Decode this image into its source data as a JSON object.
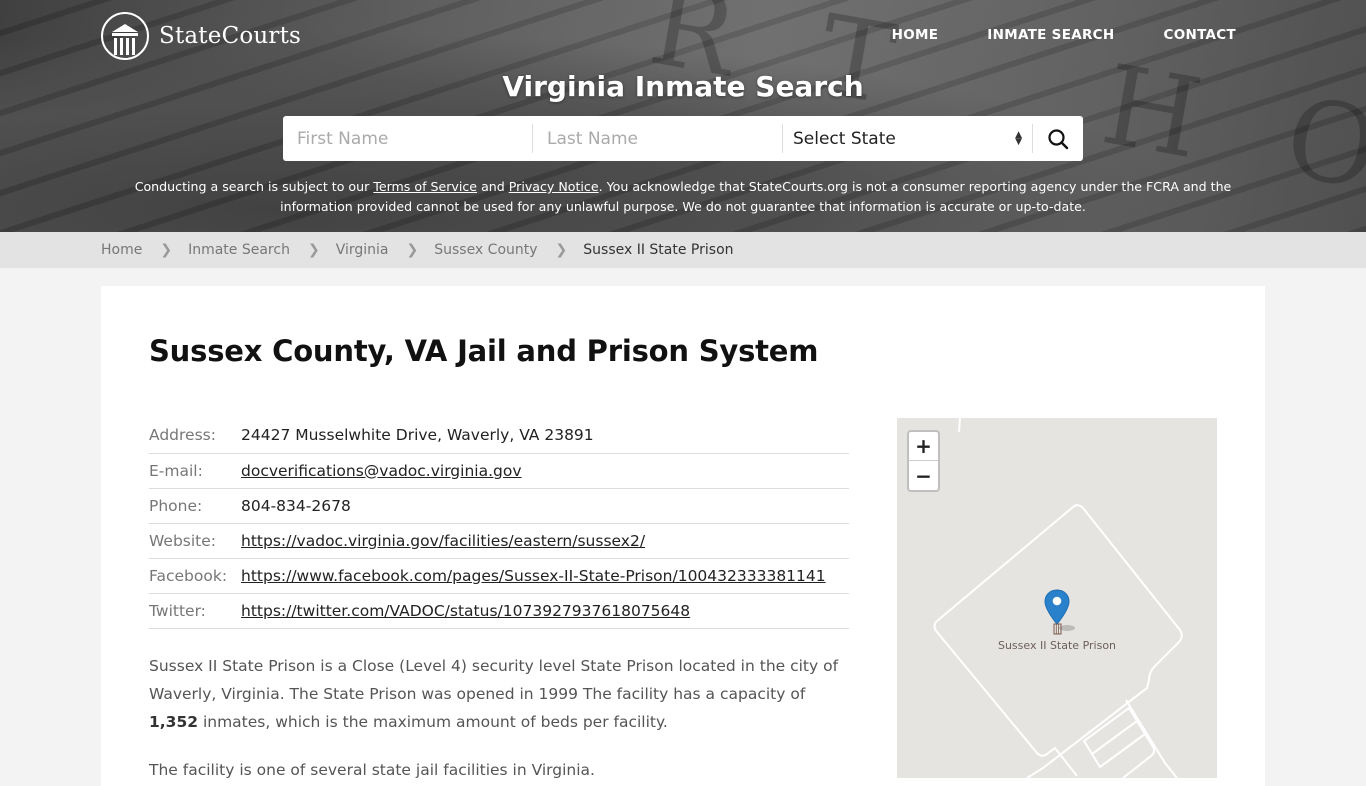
{
  "header": {
    "logo_text": "StateCourts",
    "nav": [
      "HOME",
      "INMATE SEARCH",
      "CONTACT"
    ],
    "title": "Virginia Inmate Search",
    "search": {
      "first_name_placeholder": "First Name",
      "last_name_placeholder": "Last Name",
      "state_select": "Select State"
    },
    "disclaimer": {
      "part1": "Conducting a search is subject to our ",
      "terms_link": "Terms of Service",
      "part2": " and ",
      "privacy_link": "Privacy Notice",
      "part3": ". You acknowledge that StateCourts.org is not a consumer reporting agency under the FCRA and the information provided cannot be used for any unlawful purpose. We do not guarantee that information is accurate or up-to-date."
    }
  },
  "breadcrumb": [
    "Home",
    "Inmate Search",
    "Virginia",
    "Sussex County",
    "Sussex II State Prison"
  ],
  "main": {
    "heading": "Sussex County, VA Jail and Prison System",
    "info": [
      {
        "label": "Address:",
        "value": "24427 Musselwhite Drive, Waverly, VA 23891",
        "link": false
      },
      {
        "label": "E-mail:",
        "value": "docverifications@vadoc.virginia.gov",
        "link": true
      },
      {
        "label": "Phone:",
        "value": "804-834-2678",
        "link": false
      },
      {
        "label": "Website:",
        "value": "https://vadoc.virginia.gov/facilities/eastern/sussex2/",
        "link": true
      },
      {
        "label": "Facebook:",
        "value": "https://www.facebook.com/pages/Sussex-II-State-Prison/100432333381141",
        "link": true
      },
      {
        "label": "Twitter:",
        "value": "https://twitter.com/VADOC/status/1073927937618075648",
        "link": true
      }
    ],
    "description": {
      "text1": "Sussex II State Prison is a Close (Level 4) security level State Prison located in the city of Waverly, Virginia. The State Prison was opened in 1999 The facility has a capacity of ",
      "capacity": "1,352",
      "text2": " inmates, which is the maximum amount of beds per facility."
    },
    "description2_partial": "The facility is one of several state jail facilities in Virginia."
  },
  "map": {
    "zoom_in": "+",
    "zoom_out": "−",
    "marker_label": "Sussex II State Prison",
    "marker_color": "#2a81cb"
  }
}
